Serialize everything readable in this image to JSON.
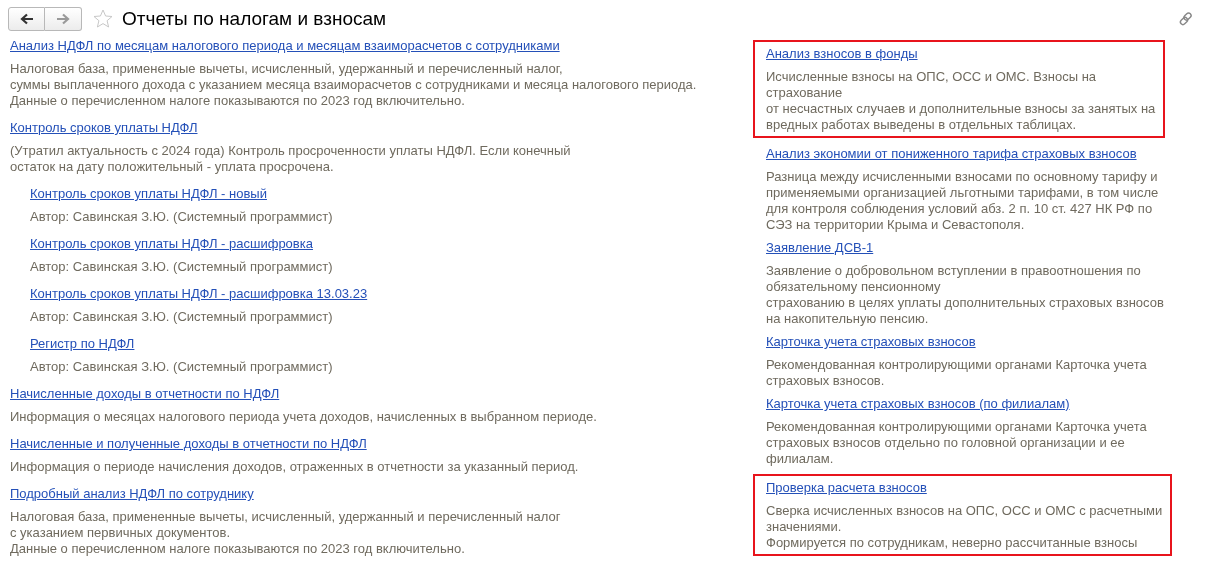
{
  "window": {
    "title": "Отчеты по налогам и взносам",
    "favorite": false
  },
  "left_reports": [
    {
      "link": "Анализ НДФЛ по месяцам налогового периода и месяцам взаиморасчетов с сотрудниками",
      "description": [
        "Налоговая база, примененные вычеты, исчисленный, удержанный и перечисленный налог,",
        "суммы выплаченного дохода с указанием месяца взаиморасчетов с сотрудниками и месяца налогового периода.",
        "Данные о перечисленном налоге показываются по 2023 год включительно."
      ]
    },
    {
      "link": "Контроль сроков уплаты НДФЛ",
      "description": [
        "(Утратил актуальность с 2024 года) Контроль просроченности уплаты НДФЛ. Если конечный",
        "остаток на дату положительный - уплата просрочена."
      ],
      "children": [
        {
          "link": "Контроль сроков уплаты НДФЛ - новый",
          "description": [
            "Автор: Савинская З.Ю. (Системный программист)"
          ]
        },
        {
          "link": "Контроль сроков уплаты НДФЛ - расшифровка",
          "description": [
            "Автор: Савинская З.Ю. (Системный программист)"
          ]
        },
        {
          "link": "Контроль сроков уплаты НДФЛ - расшифровка 13.03.23",
          "description": [
            "Автор: Савинская З.Ю. (Системный программист)"
          ]
        },
        {
          "link": "Регистр по НДФЛ",
          "description": [
            "Автор: Савинская З.Ю. (Системный программист)"
          ]
        }
      ]
    },
    {
      "link": "Начисленные доходы в отчетности по НДФЛ",
      "description": [
        "Информация о месяцах налогового периода учета доходов, начисленных в выбранном периоде."
      ]
    },
    {
      "link": "Начисленные и полученные доходы в отчетности по НДФЛ",
      "description": [
        "Информация о периоде начисления доходов, отраженных в отчетности за указанный период."
      ]
    },
    {
      "link": "Подробный анализ НДФЛ по сотруднику",
      "description": [
        "Налоговая база, примененные вычеты, исчисленный, удержанный и перечисленный налог",
        "с указанием первичных документов.",
        "Данные о перечисленном налоге показываются по 2023 год включительно."
      ]
    }
  ],
  "right_reports": [
    {
      "link": "Анализ взносов в фонды",
      "highlighted": true,
      "description": [
        "Исчисленные взносы на ОПС, ОСС и ОМС. Взносы на",
        "страхование",
        "от несчастных случаев и дополнительные взносы за занятых на",
        "вредных работах выведены в отдельных таблицах."
      ]
    },
    {
      "link": "Анализ экономии от пониженного тарифа страховых взносов",
      "highlighted": false,
      "description": [
        "Разница между исчисленными взносами по основному тарифу и",
        "применяемыми организацией льготными тарифами, в том числе",
        "для контроля соблюдения условий абз. 2 п. 10 ст. 427 НК РФ по",
        "СЭЗ на территории Крыма и Севастополя."
      ]
    },
    {
      "link": "Заявление ДСВ-1",
      "highlighted": false,
      "description": [
        "Заявление о добровольном вступлении в правоотношения по",
        "обязательному пенсионному",
        "страхованию в целях уплаты дополнительных страховых взносов",
        "на накопительную пенсию."
      ]
    },
    {
      "link": "Карточка учета страховых взносов",
      "highlighted": false,
      "description": [
        "Рекомендованная контролирующими органами Карточка учета",
        "страховых взносов."
      ]
    },
    {
      "link": "Карточка учета страховых взносов (по филиалам)",
      "highlighted": false,
      "description": [
        "Рекомендованная контролирующими органами Карточка учета",
        "страховых взносов отдельно по головной организации и ее",
        "филиалам."
      ]
    },
    {
      "link": "Проверка расчета взносов",
      "highlighted": true,
      "description": [
        "Сверка исчисленных взносов на ОПС, ОСС и ОМС с расчетными",
        "значениями.",
        "Формируется по сотрудникам, неверно рассчитанные взносы"
      ]
    }
  ]
}
